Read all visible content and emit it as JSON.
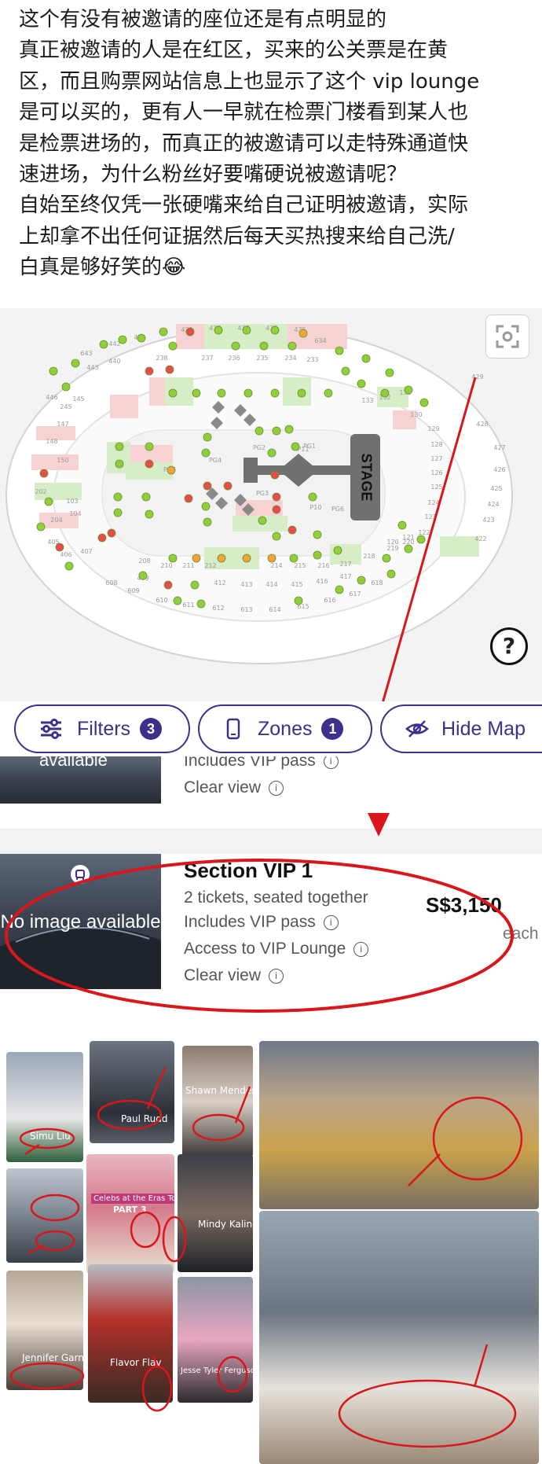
{
  "post": {
    "lines": [
      "这个有没有被邀请的座位还是有点明显的",
      "真正被邀请的人是在红区，买来的公关票是在黄",
      "区，而且购票网站信息上也显示了这个 vip lounge",
      "是可以买的，更有人一早就在检票门楼看到某人也",
      "是检票进场的，而真正的被邀请可以走特殊通道快",
      "速进场，为什么粉丝好要嘴硬说被邀请呢？",
      "自始至终仅凭一张硬嘴来给自己证明被邀请，实际",
      "上却拿不出任何证据然后每天买热搜来给自己洗/",
      "白真是够好笑的😂"
    ]
  },
  "seat_map": {
    "stage_label": "STAGE",
    "help_label": "?",
    "top_ring": [
      "643",
      "442",
      "441",
      "439",
      "438",
      "437",
      "436",
      "435",
      "634"
    ],
    "row2": [
      "443",
      "440",
      "238",
      "237",
      "236",
      "235",
      "234",
      "233"
    ],
    "right_ring": [
      "429",
      "428",
      "427",
      "426",
      "425",
      "424",
      "423",
      "422"
    ],
    "right_inner": [
      "133",
      "132",
      "131",
      "130",
      "129",
      "128",
      "127",
      "126",
      "125",
      "124",
      "123",
      "122",
      "121",
      "120"
    ],
    "left_ring": [
      "446",
      "245",
      "145",
      "147",
      "148",
      "150",
      "202",
      "103",
      "104",
      "204",
      "405",
      "406",
      "407"
    ],
    "bottom_ring": [
      "608",
      "609",
      "610",
      "611",
      "612",
      "613",
      "614",
      "615",
      "616",
      "617",
      "618"
    ],
    "bottom_row": [
      "208",
      "210",
      "211",
      "212",
      "214",
      "215",
      "216",
      "217",
      "218",
      "219",
      "220",
      "409",
      "412",
      "413",
      "414",
      "415",
      "416",
      "417"
    ],
    "floor": [
      "PG5",
      "PG4",
      "PG2",
      "PG3",
      "PG1",
      "PG6",
      "P10",
      "P11"
    ]
  },
  "filters": {
    "filters_label": "Filters",
    "filters_count": "3",
    "zones_label": "Zones",
    "zones_count": "1",
    "hide_map_label": "Hide Map"
  },
  "listing_top": {
    "thumb_text": "available",
    "includes": "Includes VIP pass",
    "clear_view": "Clear view"
  },
  "listing": {
    "image_placeholder": "No image available",
    "section": "Section VIP 1",
    "tickets": "2 tickets, seated together",
    "includes": "Includes VIP pass",
    "lounge": "Access to VIP Lounge",
    "clear_view": "Clear view",
    "price": "S$3,150",
    "price_unit": "each"
  },
  "photos": {
    "captions": [
      "Simu Liu",
      "Paul Rudd",
      "Shawn Mendes",
      "Celebs at the Eras Tour",
      "PART 3",
      "Mindy Kaling",
      "Jennifer Garner",
      "Flavor Flav",
      "Jesse Tyler Ferguson"
    ]
  },
  "colors": {
    "accent": "#3f2e8c",
    "annotation_red": "#d8161b",
    "seat_green": "#8fcf3c",
    "seat_red": "#e84b4b",
    "seat_orange": "#f2a33a",
    "zone_pink": "#f7d2d2",
    "zone_green": "#d6edc8"
  }
}
